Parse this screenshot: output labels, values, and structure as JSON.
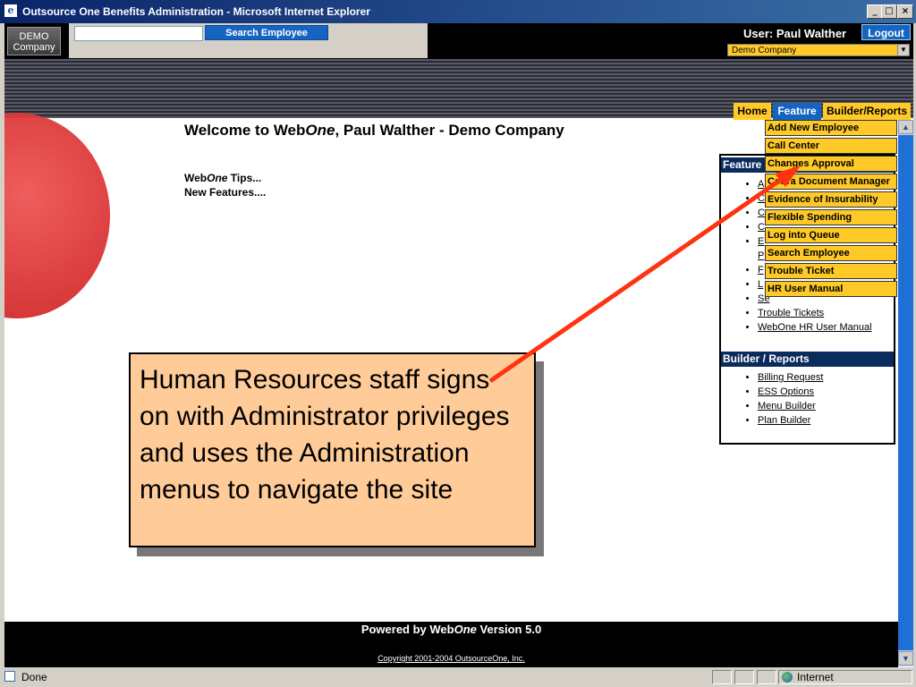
{
  "window": {
    "title": "Outsource One Benefits Administration - Microsoft Internet Explorer"
  },
  "header": {
    "logo_line1": "DEMO",
    "logo_line2": "Company",
    "search_button": "Search Employee",
    "search_value": "",
    "user_label": "User: Paul Walther",
    "logout_label": "Logout",
    "company_selected": "Demo Company"
  },
  "menubar": {
    "home": "Home",
    "feature": "Feature",
    "builder": "Builder/Reports"
  },
  "dropdown": [
    "Add New Employee",
    "Call Center",
    "Changes Approval",
    "Cobra Document Manager",
    "Evidence of Insurability",
    "Flexible Spending",
    "Log into Queue",
    "Search Employee",
    "Trouble Ticket",
    "HR User Manual"
  ],
  "welcome": {
    "pre": "Welcome to Web",
    "italic": "One",
    "post": ", Paul Walther  -  Demo Company"
  },
  "tips": {
    "tips_pre": "Web",
    "tips_italic": "One",
    "tips_post": " Tips...",
    "new_features": "New Features...."
  },
  "features_panel": {
    "title": "Feature",
    "visible_items": [
      "A",
      "C",
      "C",
      "C",
      "E",
      "P",
      "F",
      "L",
      "Se",
      "Trouble Tickets",
      "WebOne HR User Manual"
    ]
  },
  "builder_panel": {
    "title": "Builder / Reports",
    "items": [
      "Billing Request",
      "ESS Options",
      "Menu Builder",
      "Plan Builder"
    ]
  },
  "callout": {
    "text": "Human Resources staff signs on with Administrator privileges and uses the Administration menus to navigate the site"
  },
  "footer": {
    "powered_pre": "Powered by Web",
    "powered_italic": "One",
    "powered_post": " Version 5.0",
    "copyright": "Copyright 2001-2004 OutsourceOne, Inc."
  },
  "status": {
    "text": "Done",
    "zone": "Internet"
  },
  "colors": {
    "menu_yellow": "#ffca28",
    "menu_blue": "#1565c0",
    "panel_navy": "#0a2c5c",
    "callout_fill": "#ffcc99",
    "arrow_red": "#ff3311"
  }
}
